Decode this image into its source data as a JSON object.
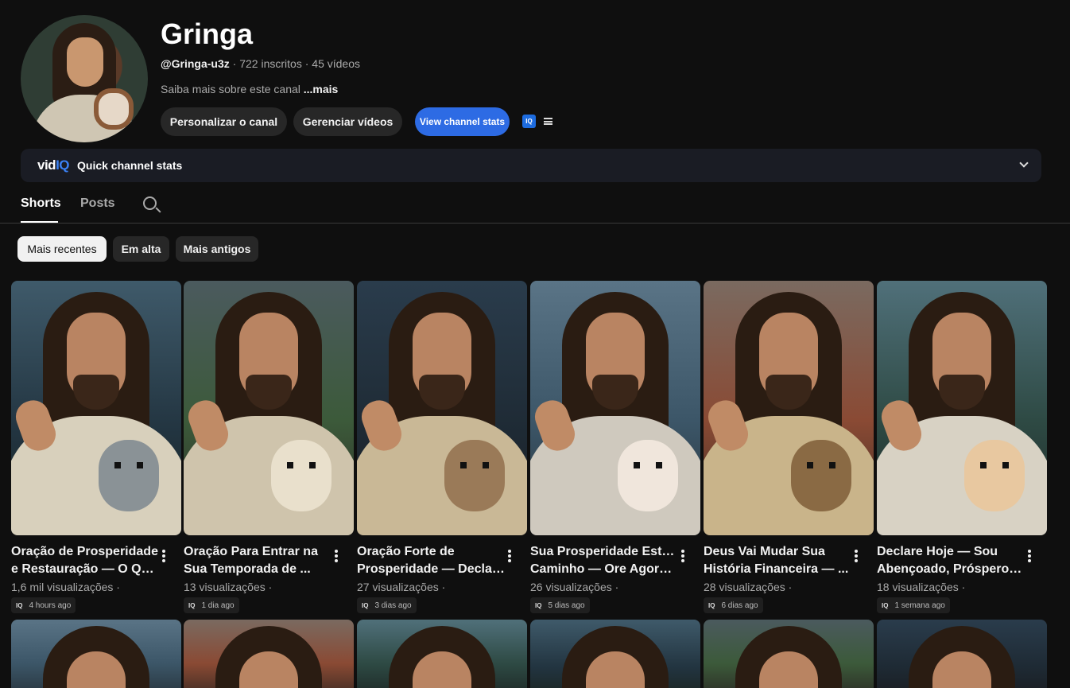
{
  "channel": {
    "name": "Gringa",
    "handle": "@Gringa-u3z",
    "subscribers": "722 inscritos",
    "videos": "45 vídeos",
    "separator": "·",
    "about": "Saiba mais sobre este canal",
    "about_more": "...mais"
  },
  "buttons": {
    "customize": "Personalizar o canal",
    "manage": "Gerenciar vídeos",
    "stats": "View channel stats",
    "iq_badge": "IQ"
  },
  "vidiq": {
    "logo_main": "vid",
    "logo_accent": "IQ",
    "label": "Quick channel stats"
  },
  "tabs": [
    {
      "label": "Shorts",
      "active": true
    },
    {
      "label": "Posts",
      "active": false
    }
  ],
  "chips": [
    {
      "label": "Mais recentes",
      "active": true
    },
    {
      "label": "Em alta",
      "active": false
    },
    {
      "label": "Mais antigos",
      "active": false
    }
  ],
  "shorts": [
    {
      "title1": "Oração de Prosperidade",
      "title2": "e Restauração — O Que...",
      "views": "1,6 mil visualizações ·",
      "iq": "IQ",
      "age": "4 hours ago",
      "animal": "koala"
    },
    {
      "title1": "Oração Para Entrar na",
      "title2": "Sua Temporada de ...",
      "views": "13 visualizações ·",
      "iq": "IQ",
      "age": "1 dia ago",
      "animal": "llama"
    },
    {
      "title1": "Oração Forte de",
      "title2": "Prosperidade — Declar...",
      "views": "27 visualizações ·",
      "iq": "IQ",
      "age": "3 dias ago",
      "animal": "meerkat"
    },
    {
      "title1": "Sua Prosperidade Está a",
      "title2": "Caminho — Ore Agora ...",
      "views": "26 visualizações ·",
      "iq": "IQ",
      "age": "5 dias ago",
      "animal": "kitten"
    },
    {
      "title1": "Deus Vai Mudar Sua",
      "title2": "História Financeira — ...",
      "views": "28 visualizações ·",
      "iq": "IQ",
      "age": "6 dias ago",
      "animal": "bengal-cat"
    },
    {
      "title1": "Declare Hoje — Sou",
      "title2": "Abençoado, Próspero e...",
      "views": "18 visualizações ·",
      "iq": "IQ",
      "age": "1 semana ago",
      "animal": "pomeranian"
    }
  ]
}
